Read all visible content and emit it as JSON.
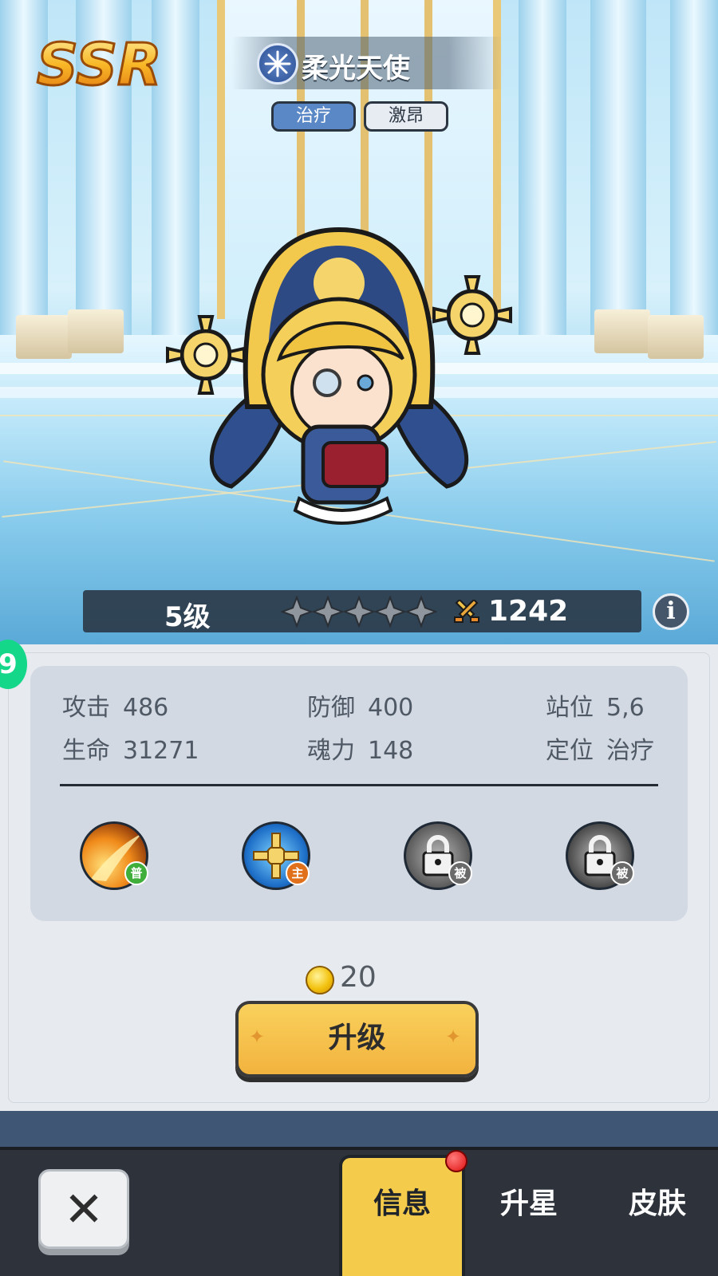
{
  "hero": {
    "rarity": "SSR",
    "name": "柔光天使",
    "tags": [
      "治疗",
      "激昂"
    ],
    "level": "5级",
    "stars": 5,
    "stars_lit": 0,
    "power": "1242"
  },
  "stats": {
    "attack": {
      "label": "攻击",
      "value": "486"
    },
    "defense": {
      "label": "防御",
      "value": "400"
    },
    "position": {
      "label": "站位",
      "value": "5,6"
    },
    "hp": {
      "label": "生命",
      "value": "31271"
    },
    "soul": {
      "label": "魂力",
      "value": "148"
    },
    "role": {
      "label": "定位",
      "value": "治疗"
    }
  },
  "skills": [
    {
      "badge": "普",
      "locked": false,
      "badge_color": "#3fae3a"
    },
    {
      "badge": "主",
      "locked": false,
      "badge_color": "#e0701a"
    },
    {
      "badge": "被",
      "locked": true,
      "badge_color": "#6a6a6a"
    },
    {
      "badge": "被",
      "locked": true,
      "badge_color": "#6a6a6a"
    }
  ],
  "upgrade": {
    "cost": "20",
    "button_label": "升级"
  },
  "tabs": {
    "info": "信息",
    "star_up": "升星",
    "skin": "皮肤",
    "close_icon": "close-icon"
  },
  "info_icon_glyph": "i",
  "side_tab_glyph": "9",
  "colors": {
    "accent_gold": "#f4cb4a",
    "panel": "#e7ebf0",
    "dark": "#2e333b"
  }
}
